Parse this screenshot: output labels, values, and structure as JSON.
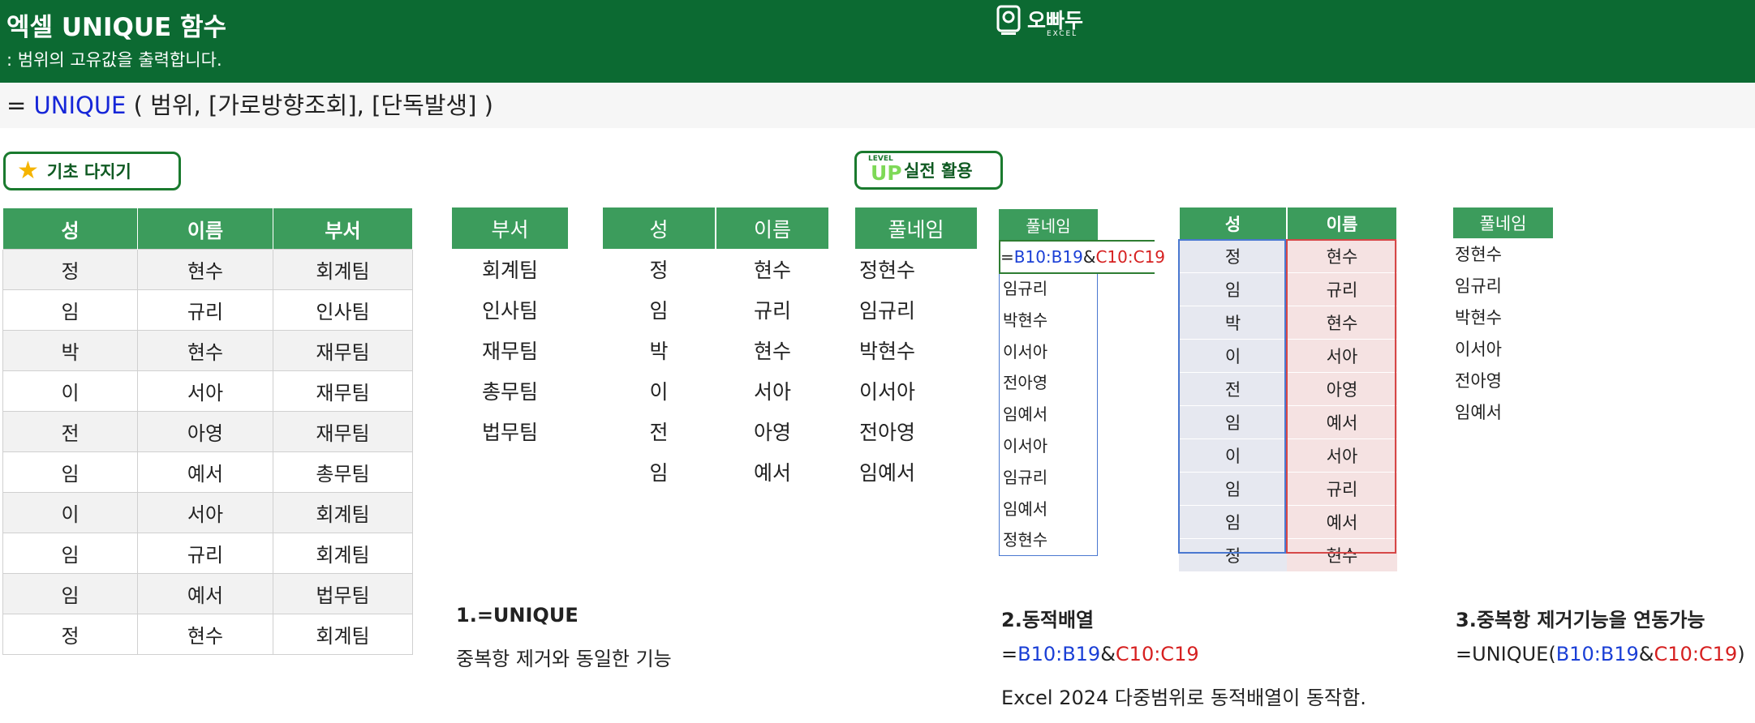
{
  "header": {
    "title": "엑셀 UNIQUE 함수",
    "subtitle": ": 범위의 고유값을 출력합니다.",
    "logo_text": "오빠두",
    "logo_sub": "EXCEL"
  },
  "syntax": {
    "prefix": "= ",
    "function": "UNIQUE",
    "args": " ( 범위, [가로방향조회], [단독발생] )"
  },
  "badges": {
    "basic": "기초 다지기",
    "level_small": "LEVEL",
    "level_up": "UP",
    "level": "실전 활용"
  },
  "source_table": {
    "headers": [
      "성",
      "이름",
      "부서"
    ],
    "rows": [
      [
        "정",
        "현수",
        "회계팀"
      ],
      [
        "임",
        "규리",
        "인사팀"
      ],
      [
        "박",
        "현수",
        "재무팀"
      ],
      [
        "이",
        "서아",
        "재무팀"
      ],
      [
        "전",
        "아영",
        "재무팀"
      ],
      [
        "임",
        "예서",
        "총무팀"
      ],
      [
        "이",
        "서아",
        "회계팀"
      ],
      [
        "임",
        "규리",
        "회계팀"
      ],
      [
        "임",
        "예서",
        "법무팀"
      ],
      [
        "정",
        "현수",
        "회계팀"
      ]
    ]
  },
  "dept_table": {
    "header": "부서",
    "rows": [
      "회계팀",
      "인사팀",
      "재무팀",
      "총무팀",
      "법무팀"
    ]
  },
  "name_table": {
    "headers": [
      "성",
      "이름"
    ],
    "rows": [
      [
        "정",
        "현수"
      ],
      [
        "임",
        "규리"
      ],
      [
        "박",
        "현수"
      ],
      [
        "이",
        "서아"
      ],
      [
        "전",
        "아영"
      ],
      [
        "임",
        "예서"
      ]
    ]
  },
  "fullname_table": {
    "header": "풀네임",
    "rows": [
      "정현수",
      "임규리",
      "박현수",
      "이서아",
      "전아영",
      "임예서"
    ]
  },
  "dynamic_demo": {
    "header": "풀네임",
    "formula_eq": "=",
    "formula_range1": "B10:B19",
    "formula_amp": "&",
    "formula_range2": "C10:C19",
    "rows": [
      "임규리",
      "박현수",
      "이서아",
      "전아영",
      "임예서",
      "이서아",
      "임규리",
      "임예서",
      "정현수"
    ]
  },
  "highlight_table": {
    "headers": [
      "성",
      "이름"
    ],
    "rows": [
      [
        "정",
        "현수"
      ],
      [
        "임",
        "규리"
      ],
      [
        "박",
        "현수"
      ],
      [
        "이",
        "서아"
      ],
      [
        "전",
        "아영"
      ],
      [
        "임",
        "예서"
      ],
      [
        "이",
        "서아"
      ],
      [
        "임",
        "규리"
      ],
      [
        "임",
        "예서"
      ],
      [
        "정",
        "현수"
      ]
    ]
  },
  "result_list": {
    "header": "풀네임",
    "rows": [
      "정현수",
      "임규리",
      "박현수",
      "이서아",
      "전아영",
      "임예서"
    ]
  },
  "notes": {
    "n1_title": "1.=UNIQUE",
    "n1_line": "중복항 제거와 동일한 기능",
    "n2_title": "2.동적배열",
    "n2_eq": "=",
    "n2_range1": "B10:B19",
    "n2_amp": "&",
    "n2_range2": "C10:C19",
    "n2_line2": "Excel 2024 다중범위로 동적배열이 동작함.",
    "n3_title": "3.중복항 제거기능을 연동가능",
    "n3_prefix": "=UNIQUE(",
    "n3_range1": "B10:B19",
    "n3_amp": "&",
    "n3_range2": "C10:C19",
    "n3_suffix": ")"
  },
  "colors": {
    "header_bg": "#0c6a32",
    "table_header": "#3c9c5c",
    "function_blue": "#1626d8",
    "range_blue": "#1a3fd6",
    "range_red": "#d62020"
  }
}
